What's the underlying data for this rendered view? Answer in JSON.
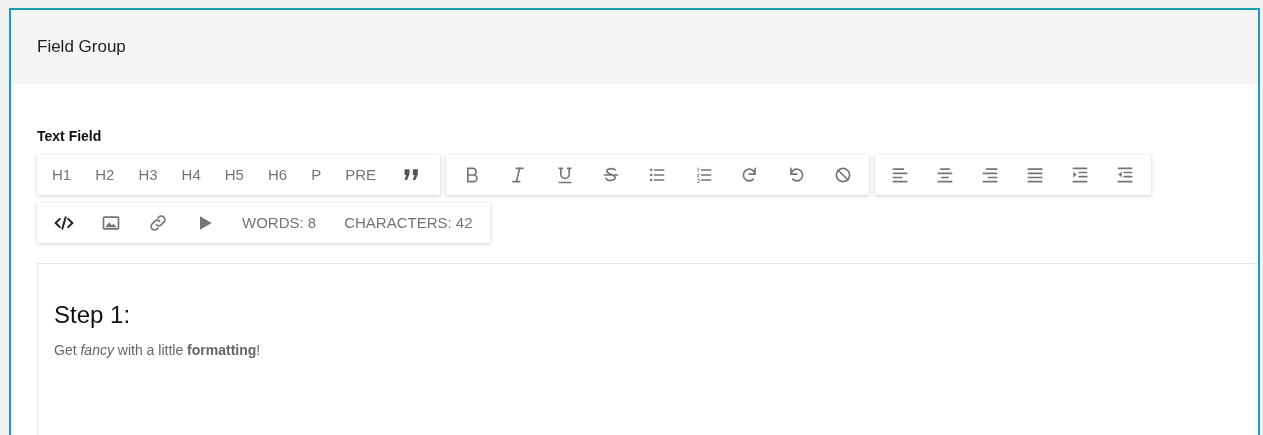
{
  "panel": {
    "title": "Field Group"
  },
  "field": {
    "label": "Text Field"
  },
  "toolbar": {
    "block_formats": [
      "H1",
      "H2",
      "H3",
      "H4",
      "H5",
      "H6",
      "P",
      "PRE"
    ],
    "counters": [
      "WORDS: 8",
      "CHARACTERS: 42"
    ]
  },
  "editor": {
    "heading": "Step 1:",
    "paragraph": "Get *fancy* with a little **formatting**!"
  }
}
